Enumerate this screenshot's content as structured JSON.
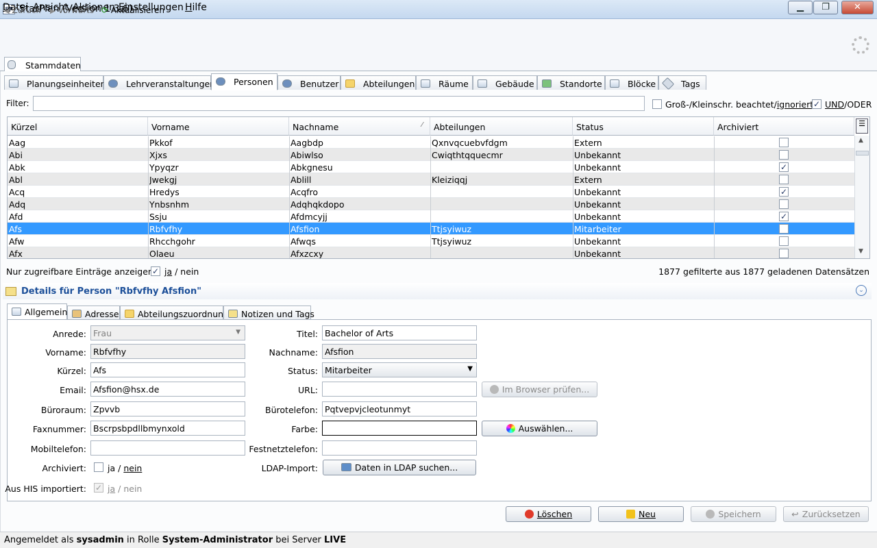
{
  "window": {
    "title": "StarPlan (Version 1.3.6)",
    "icon_text": "SP",
    "min": "▁",
    "max": "❐",
    "close": "✕"
  },
  "menu": [
    "Datei",
    "Ansicht",
    "Aktionen",
    "Einstellungen",
    "Hilfe"
  ],
  "nav": {
    "back": "Zurück",
    "forward": "Vorwärts",
    "refresh": "Aktualisieren"
  },
  "main_tab": "Stammdaten",
  "tabs": [
    "Planungseinheiten",
    "Lehrveranstaltungen",
    "Personen",
    "Benutzer",
    "Abteilungen",
    "Räume",
    "Gebäude",
    "Standorte",
    "Blöcke",
    "Tags"
  ],
  "filter": {
    "label": "Filter:",
    "value": "",
    "case_label_pre": "Groß-/Kleinschr. beachtet/",
    "case_label_link": "ignoriert",
    "case_checked": false,
    "und_label": "UND",
    "oder_label": "/ODER",
    "und_checked": true
  },
  "table": {
    "columns": [
      "Kürzel",
      "Vorname",
      "Nachname",
      "Abteilungen",
      "Status",
      "Archiviert"
    ],
    "sort_mark": "⁄",
    "rows": [
      {
        "kuerzel": "Aag",
        "vorname": "Pkkof",
        "nachname": "Aagbdp",
        "abteilungen": "Qxnvqcuebvfdgm",
        "status": "Extern",
        "archiviert": false
      },
      {
        "kuerzel": "Abi",
        "vorname": "Xjxs",
        "nachname": "Abiwlso",
        "abteilungen": "Cwiqthtqquecmr",
        "status": "Unbekannt",
        "archiviert": false
      },
      {
        "kuerzel": "Abk",
        "vorname": "Ypyqzr",
        "nachname": "Abkgnesu",
        "abteilungen": "",
        "status": "Unbekannt",
        "archiviert": true
      },
      {
        "kuerzel": "Abl",
        "vorname": "Jwekgj",
        "nachname": "Ablill",
        "abteilungen": "Kleiziqqj",
        "status": "Extern",
        "archiviert": false
      },
      {
        "kuerzel": "Acq",
        "vorname": "Hredys",
        "nachname": "Acqfro",
        "abteilungen": "",
        "status": "Unbekannt",
        "archiviert": true
      },
      {
        "kuerzel": "Adq",
        "vorname": "Ynbsnhm",
        "nachname": "Adqhqkdopo",
        "abteilungen": "",
        "status": "Unbekannt",
        "archiviert": false
      },
      {
        "kuerzel": "Afd",
        "vorname": "Ssju",
        "nachname": "Afdmcyjj",
        "abteilungen": "",
        "status": "Unbekannt",
        "archiviert": true
      },
      {
        "kuerzel": "Afs",
        "vorname": "Rbfvfhy",
        "nachname": "Afsfion",
        "abteilungen": "Ttjsyiwuz",
        "status": "Mitarbeiter",
        "archiviert": false,
        "selected": true
      },
      {
        "kuerzel": "Afw",
        "vorname": "Rhcchgohr",
        "nachname": "Afwqs",
        "abteilungen": "Ttjsyiwuz",
        "status": "Unbekannt",
        "archiviert": false
      },
      {
        "kuerzel": "Afx",
        "vorname": "Olaeu",
        "nachname": "Afxzcxy",
        "abteilungen": "",
        "status": "Unbekannt",
        "archiviert": false
      }
    ]
  },
  "accessible": {
    "label": "Nur zugreifbare Einträge anzeigen:",
    "ja": "ja",
    "nein": "/ nein",
    "checked": true
  },
  "record_count": "1877 gefilterte aus 1877 geladenen Datensätzen",
  "details": {
    "title": "Details für Person \"Rbfvfhy Afsfion\"",
    "tabs": [
      "Allgemein",
      "Adresse",
      "Abteilungszuordnung",
      "Notizen und Tags"
    ],
    "labels": {
      "anrede": "Anrede:",
      "vorname": "Vorname:",
      "kuerzel": "Kürzel:",
      "email": "Email:",
      "bueroraum": "Büroraum:",
      "faxnummer": "Faxnummer:",
      "mobiltelefon": "Mobiltelefon:",
      "archiviert": "Archiviert:",
      "his": "Aus HIS importiert:",
      "titel": "Titel:",
      "nachname": "Nachname:",
      "status": "Status:",
      "url": "URL:",
      "buerotelefon": "Bürotelefon:",
      "farbe": "Farbe:",
      "festnetz": "Festnetztelefon:",
      "ldap": "LDAP-Import:"
    },
    "values": {
      "anrede": "Frau",
      "vorname": "Rbfvfhy",
      "kuerzel": "Afs",
      "email": "Afsfion@hsx.de",
      "bueroraum": "Zpvvb",
      "faxnummer": "Bscrpsbpdllbmynxold",
      "mobiltelefon": "",
      "titel": "Bachelor of Arts",
      "nachname": "Afsfion",
      "status": "Mitarbeiter",
      "url": "",
      "buerotelefon": "Pqtvepvjcleotunmyt",
      "festnetz": ""
    },
    "ja": "ja",
    "nein": "nein",
    "slash": "/",
    "buttons": {
      "browser": "Im Browser prüfen...",
      "choose": "Auswählen...",
      "ldap": "Daten in LDAP suchen..."
    },
    "farbe_color": "#ffffff"
  },
  "actions": {
    "delete": "Löschen",
    "new": "Neu",
    "save": "Speichern",
    "reset": "Zurücksetzen"
  },
  "status": {
    "pre": "Angemeldet als ",
    "user": "sysadmin",
    "mid": " in Rolle ",
    "role": "System-Administrator",
    "mid2": " bei Server ",
    "server": "LIVE"
  }
}
